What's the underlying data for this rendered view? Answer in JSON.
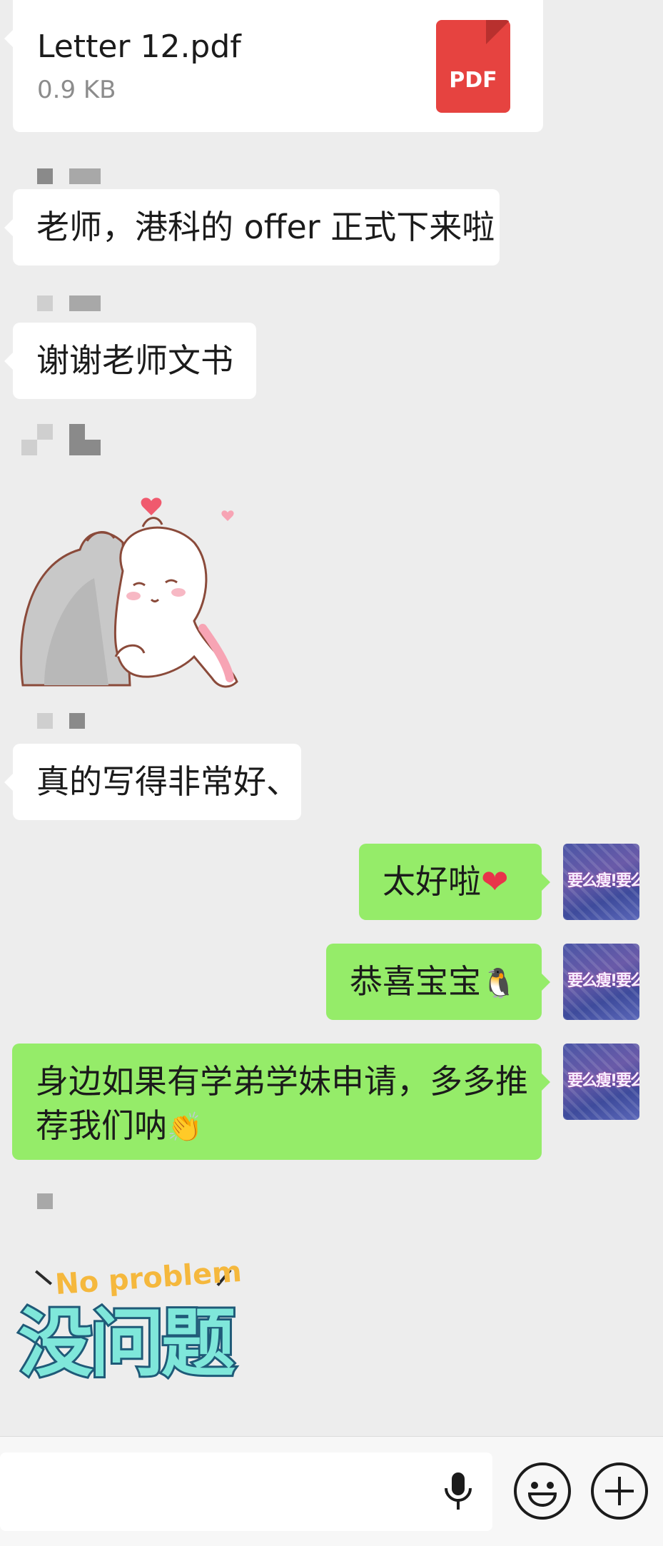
{
  "chat": {
    "file_message": {
      "name": "Letter 12.pdf",
      "size": "0.9 KB",
      "badge": "PDF"
    },
    "messages": [
      {
        "text": "老师，港科的 offer 正式下来啦"
      },
      {
        "text": "谢谢老师文书"
      },
      {
        "text": "真的写得非常好、"
      },
      {
        "text": "太好啦"
      },
      {
        "text": "恭喜宝宝"
      },
      {
        "text_line1": "身边如果有学弟学妹申请，多多推",
        "text_line2": "荐我们呐"
      }
    ],
    "emojis": {
      "heart": "❤",
      "penguin": "🐧",
      "clap": "👏"
    },
    "stickers": {
      "rabbit": {
        "icon": "rabbit-sticker"
      },
      "no_problem": {
        "en": "No problem",
        "zh": "没问题"
      }
    },
    "avatar": {
      "text": "要么瘦!要么死"
    }
  },
  "input_bar": {
    "voice_icon": "microphone-icon",
    "emoji_icon": "smiley-icon",
    "plus_icon": "plus-icon"
  },
  "colors": {
    "background": "#ededed",
    "bubble_self": "#95ec69",
    "bubble_other": "#ffffff",
    "pdf_red": "#e64340"
  }
}
